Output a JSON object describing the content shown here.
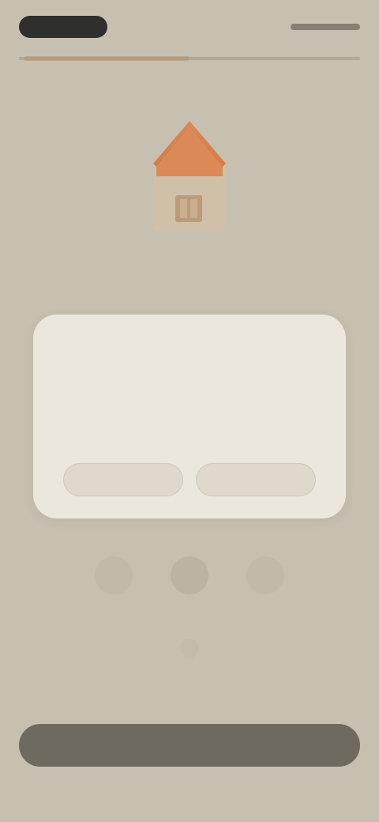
{
  "header": {
    "left_pill": "",
    "right_action": ""
  },
  "hero": {
    "title": ""
  },
  "card": {
    "title": "",
    "body": "",
    "primary": "",
    "secondary": ""
  },
  "nav": {
    "left": "",
    "center": "",
    "right": ""
  },
  "cta": {
    "label": ""
  },
  "colors": {
    "background": "#c7c0b1",
    "card": "#ece7dd",
    "accent": "#d57b45",
    "bottom_button": "#6f6a60"
  },
  "icons": {
    "top_pill": "status-pill",
    "house": "house-icon",
    "nav_left": "home-icon",
    "nav_center": "center-action-icon",
    "nav_right": "profile-icon",
    "dots": "page-indicator-icon"
  }
}
